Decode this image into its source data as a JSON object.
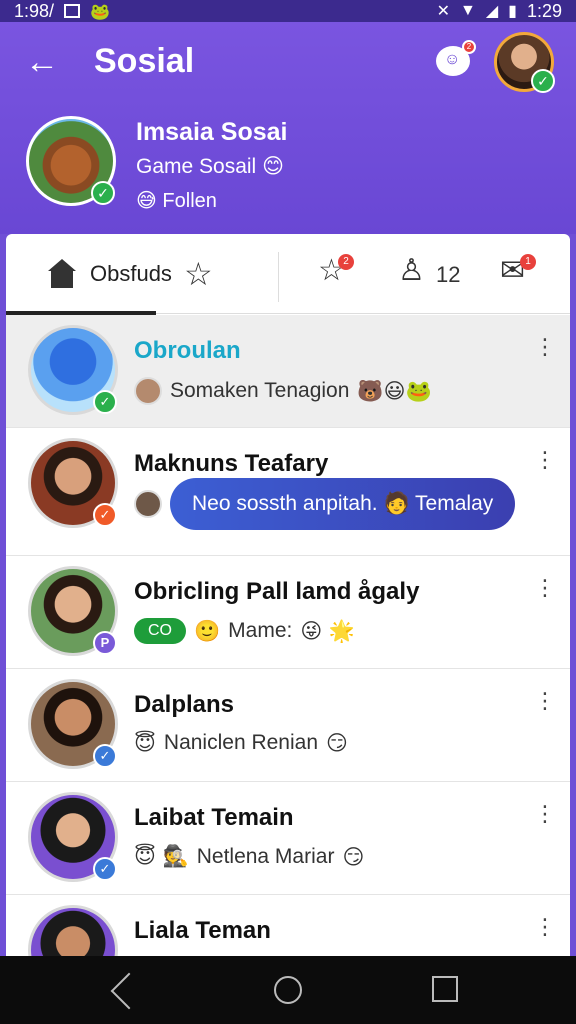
{
  "status_bar": {
    "time_left": "1:98/",
    "time_right": "1:29"
  },
  "header": {
    "title": "Sosial",
    "chat_badge": "2",
    "profile_name": "Imsaia Sosai",
    "profile_sub": "Game Sosail",
    "profile_follow": "Follen"
  },
  "tabs": {
    "active_label": "Obsfuds",
    "count": "12",
    "badge_a": "2",
    "badge_b": "1"
  },
  "chats": [
    {
      "name": "Obroulan",
      "preview": "Somaken Tenagion",
      "emojis": "🐻😃🐸"
    },
    {
      "name": "Maknuns Teafary",
      "bubble": "Neo sossth anpitah. 🧑 Temalay"
    },
    {
      "name": "Obricling Pall lamd ågaly",
      "pill": "CO",
      "preview": "Mame:",
      "emojis": "😜 🌟"
    },
    {
      "name": "Dalplans",
      "preview": "Naniclen Renian",
      "emojis_pre": "😇",
      "emojis": "😏"
    },
    {
      "name": "Laibat Temain",
      "preview": "Netlena Mariar",
      "emojis_pre": "😇 🕵",
      "emojis": "😏"
    },
    {
      "name": "Liala Teman"
    }
  ],
  "colors": {
    "accent": "#6947d4",
    "online": "#2bb04c",
    "badge": "#e8413c"
  }
}
